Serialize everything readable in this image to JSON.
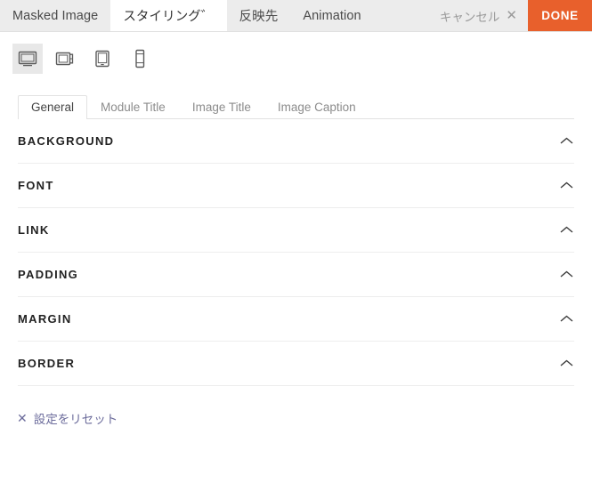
{
  "topbar": {
    "tabs": [
      {
        "label": "Masked Image",
        "active": false
      },
      {
        "label": "スタイリング゛",
        "active": true
      },
      {
        "label": "反映先",
        "active": false
      },
      {
        "label": "Animation",
        "active": false
      }
    ],
    "cancel_label": "キャンセル",
    "cancel_icon": "close-icon",
    "done_label": "DONE",
    "done_color": "#e8602c",
    "background_color": "#ececec"
  },
  "device_toolbar": {
    "devices": [
      {
        "name": "desktop",
        "icon": "desktop-icon",
        "active": true
      },
      {
        "name": "laptop",
        "icon": "laptop-icon",
        "active": false
      },
      {
        "name": "tablet",
        "icon": "tablet-icon",
        "active": false
      },
      {
        "name": "phone",
        "icon": "phone-icon",
        "active": false
      }
    ],
    "active_background": "#e8e8e8"
  },
  "subtabs": [
    {
      "label": "General",
      "active": true
    },
    {
      "label": "Module Title",
      "active": false
    },
    {
      "label": "Image Title",
      "active": false
    },
    {
      "label": "Image Caption",
      "active": false
    }
  ],
  "sections": [
    {
      "label": "BACKGROUND",
      "chevron": "chevron-up-icon"
    },
    {
      "label": "FONT",
      "chevron": "chevron-up-icon"
    },
    {
      "label": "LINK",
      "chevron": "chevron-up-icon"
    },
    {
      "label": "PADDING",
      "chevron": "chevron-up-icon"
    },
    {
      "label": "MARGIN",
      "chevron": "chevron-up-icon"
    },
    {
      "label": "BORDER",
      "chevron": "chevron-up-icon"
    }
  ],
  "reset": {
    "label": "設定をリセット",
    "icon": "close-icon",
    "color": "#6d6d9c"
  }
}
